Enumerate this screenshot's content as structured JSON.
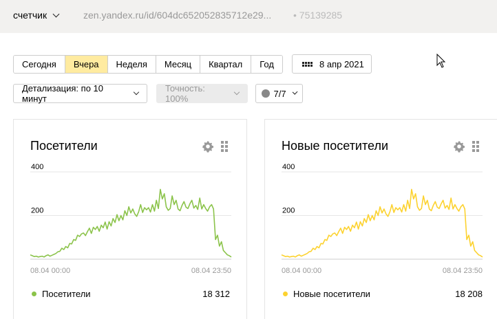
{
  "header": {
    "counter_label": "счетчик",
    "url": "zen.yandex.ru/id/604dc652052835712e29...",
    "counter_id": "• 75139285"
  },
  "periods": [
    "Сегодня",
    "Вчера",
    "Неделя",
    "Месяц",
    "Квартал",
    "Год"
  ],
  "active_period": "Вчера",
  "date_label": "8 апр 2021",
  "detail_label": "Детализация: по 10 минут",
  "accuracy_label": "Точность: 100%",
  "segments_label": "7/7",
  "colors": {
    "green": "#8bc34a",
    "yellow": "#fcd22f",
    "active": "#ffeba0"
  },
  "widgets": [
    {
      "title": "Посетители",
      "legend": "Посетители",
      "total": "18 312",
      "color": "#8bc34a",
      "y_ticks": [
        "400",
        "200"
      ],
      "x_start": "08.04 00:00",
      "x_end": "08.04 23:50"
    },
    {
      "title": "Новые посетители",
      "legend": "Новые посетители",
      "total": "18 208",
      "color": "#fcd22f",
      "y_ticks": [
        "400",
        "200"
      ],
      "x_start": "08.04 00:00",
      "x_end": "08.04 23:50"
    }
  ],
  "chart_data": [
    {
      "type": "line",
      "title": "Посетители",
      "xlabel": "",
      "ylabel": "",
      "x_range": [
        "08.04 00:00",
        "08.04 23:50"
      ],
      "ylim": [
        0,
        400
      ],
      "grid": true,
      "series": [
        {
          "name": "Посетители",
          "values": [
            20,
            16,
            12,
            14,
            10,
            12,
            14,
            10,
            16,
            20,
            14,
            18,
            22,
            26,
            34,
            36,
            50,
            44,
            58,
            52,
            72,
            70,
            90,
            86,
            110,
            104,
            116,
            120,
            108,
            126,
            142,
            118,
            146,
            136,
            150,
            128,
            156,
            144,
            170,
            138,
            172,
            152,
            186,
            168,
            204,
            176,
            200,
            180,
            222,
            200,
            240,
            212,
            230,
            208,
            196,
            218,
            250,
            214,
            236,
            226,
            236,
            216,
            250,
            220,
            270,
            232,
            320,
            276,
            300,
            240,
            224,
            232,
            290,
            250,
            270,
            230,
            222,
            246,
            264,
            238,
            232,
            254,
            270,
            234,
            246,
            228,
            280,
            230,
            250,
            232,
            220,
            240,
            250,
            230,
            90,
            110,
            60,
            80,
            40,
            30,
            20,
            16,
            10
          ]
        }
      ]
    },
    {
      "type": "line",
      "title": "Новые посетители",
      "xlabel": "",
      "ylabel": "",
      "x_range": [
        "08.04 00:00",
        "08.04 23:50"
      ],
      "ylim": [
        0,
        400
      ],
      "grid": true,
      "series": [
        {
          "name": "Новые посетители",
          "values": [
            20,
            16,
            12,
            14,
            10,
            12,
            14,
            10,
            16,
            20,
            14,
            18,
            22,
            26,
            34,
            36,
            50,
            44,
            58,
            52,
            72,
            70,
            90,
            86,
            110,
            104,
            116,
            120,
            108,
            126,
            142,
            118,
            146,
            136,
            150,
            128,
            156,
            144,
            170,
            138,
            172,
            152,
            186,
            168,
            204,
            176,
            200,
            180,
            222,
            200,
            240,
            212,
            230,
            208,
            196,
            218,
            250,
            214,
            236,
            226,
            236,
            216,
            250,
            220,
            270,
            232,
            320,
            276,
            300,
            240,
            224,
            232,
            290,
            250,
            270,
            230,
            222,
            246,
            264,
            238,
            232,
            254,
            270,
            234,
            246,
            228,
            280,
            230,
            250,
            232,
            220,
            240,
            250,
            230,
            90,
            110,
            60,
            80,
            40,
            30,
            20,
            16,
            10
          ]
        }
      ]
    }
  ]
}
